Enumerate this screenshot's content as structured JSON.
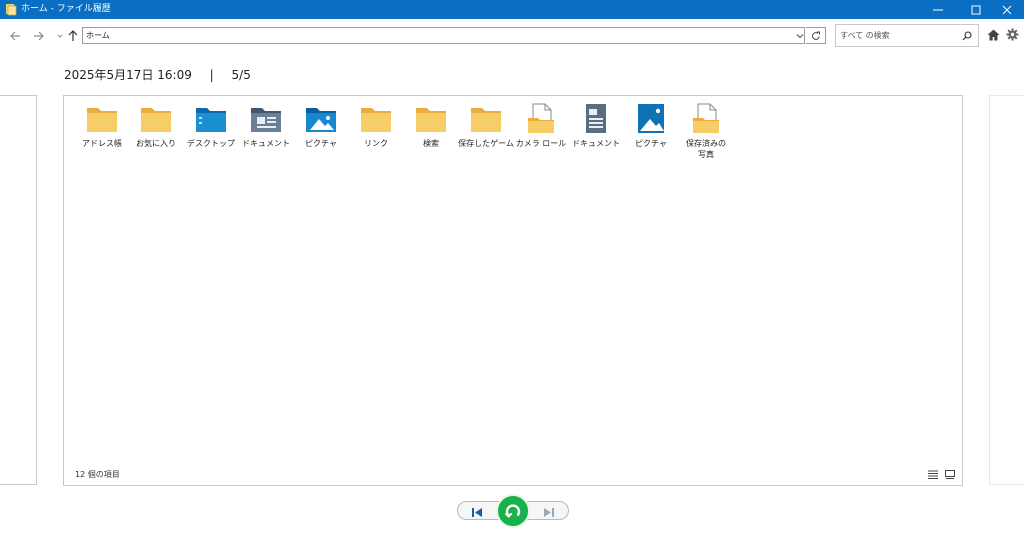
{
  "window": {
    "title": "ホーム - ファイル履歴",
    "title_bar_color": "#0a6fc2",
    "controls": [
      "minimize-icon",
      "maximize-icon",
      "close-icon"
    ]
  },
  "toolbar": {
    "back_icon": "arrow-left-icon",
    "forward_icon": "arrow-right-icon",
    "recent_icon": "chevron-down-icon",
    "up_icon": "arrow-up-icon",
    "address_value": "ホーム",
    "refresh_icon": "refresh-icon",
    "search_placeholder": "すべて の検索",
    "search_icon": "search-icon",
    "home_icon": "home-icon",
    "settings_icon": "gear-icon"
  },
  "header": {
    "date": "2025年5月17日 16:09",
    "separator": "|",
    "version": "5/5"
  },
  "items": [
    {
      "label": "アドレス帳",
      "icon": "folder-icon"
    },
    {
      "label": "お気に入り",
      "icon": "folder-icon"
    },
    {
      "label": "デスクトップ",
      "icon": "desktop-folder-icon"
    },
    {
      "label": "ドキュメント",
      "icon": "documents-folder-icon"
    },
    {
      "label": "ピクチャ",
      "icon": "pictures-folder-icon"
    },
    {
      "label": "リンク",
      "icon": "folder-icon"
    },
    {
      "label": "検索",
      "icon": "folder-icon"
    },
    {
      "label": "保存したゲーム",
      "icon": "folder-icon"
    },
    {
      "label": "カメラ ロール",
      "icon": "library-folder-icon"
    },
    {
      "label": "ドキュメント",
      "icon": "document-library-icon"
    },
    {
      "label": "ピクチャ",
      "icon": "picture-library-icon"
    },
    {
      "label": "保存済みの写真",
      "icon": "library-folder-icon"
    }
  ],
  "status": {
    "count": "12 個の項目",
    "view_details_icon": "details-view-icon",
    "view_icons_icon": "large-icons-view-icon"
  },
  "playback": {
    "previous_icon": "previous-version-icon",
    "restore_icon": "restore-icon",
    "next_icon": "next-version-icon",
    "restore_color": "#18b14a"
  },
  "colors": {
    "folder": "#f5c65b",
    "accent_blue": "#0a6fc2",
    "doc_gray": "#5b6d82"
  }
}
